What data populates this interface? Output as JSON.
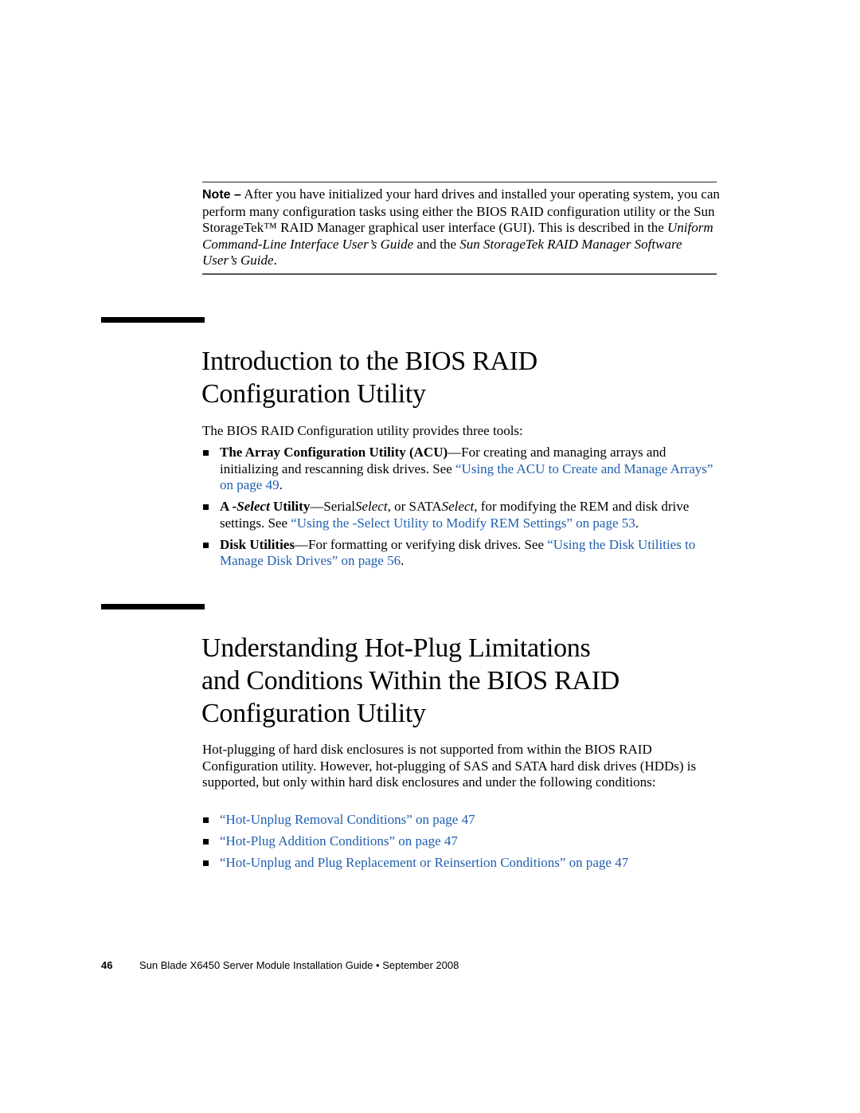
{
  "note": {
    "label": "Note –",
    "segments": [
      {
        "text": " After you have initialized your hard drives and installed your operating system, you can perform many configuration tasks using either the BIOS RAID configuration utility or the Sun StorageTek™ RAID Manager graphical user interface (GUI). This is described in the ",
        "style": "normal"
      },
      {
        "text": "Uniform Command-Line Interface User’s Guide",
        "style": "italic"
      },
      {
        "text": " and the ",
        "style": "normal"
      },
      {
        "text": "Sun StorageTek RAID Manager Software User’s Guide",
        "style": "italic"
      },
      {
        "text": ".",
        "style": "normal"
      }
    ]
  },
  "section1": {
    "title_line1": "Introduction to the BIOS RAID",
    "title_line2": "Configuration Utility",
    "intro": "The BIOS RAID Configuration utility provides three tools:",
    "bullets": [
      {
        "lead_bold": "The Array Configuration Utility (ACU)",
        "text": "—For creating and managing arrays and initializing and rescanning disk drives. See ",
        "link": "“Using the ACU to Create and Manage Arrays” on page 49",
        "tail": "."
      },
      {
        "lead_bold_a": "A ",
        "lead_bold_italic": "-Select",
        "lead_bold_b": " Utility",
        "text_a": "—Serial",
        "text_italic_a": "Select",
        "text_b": ", or SATA",
        "text_italic_b": "Select",
        "text_c": ", for modifying the REM and disk drive settings. See ",
        "link": "“Using the -Select Utility to Modify REM Settings” on page 53",
        "tail": "."
      },
      {
        "lead_bold": "Disk Utilities",
        "text": "—For formatting or verifying disk drives. See ",
        "link": "“Using the Disk Utilities to Manage Disk Drives” on page 56",
        "tail": "."
      }
    ]
  },
  "section2": {
    "title_line1": "Understanding Hot-Plug Limitations",
    "title_line2": "and Conditions Within the BIOS RAID",
    "title_line3": "Configuration Utility",
    "intro": "Hot-plugging of hard disk enclosures is not supported from within the BIOS RAID Configuration utility. However, hot-plugging of SAS and SATA hard disk drives (HDDs) is supported, but only within hard disk enclosures and under the following conditions:",
    "links": [
      "“Hot-Unplug Removal Conditions” on page 47",
      "“Hot-Plug Addition Conditions” on page 47",
      "“Hot-Unplug and Plug Replacement or Reinsertion Conditions” on page 47"
    ]
  },
  "footer": {
    "page_number": "46",
    "title": "Sun Blade X6450 Server Module Installation Guide",
    "separator": "•",
    "date": "September 2008"
  },
  "colors": {
    "link": "#1f5fb0",
    "text": "#000000"
  }
}
